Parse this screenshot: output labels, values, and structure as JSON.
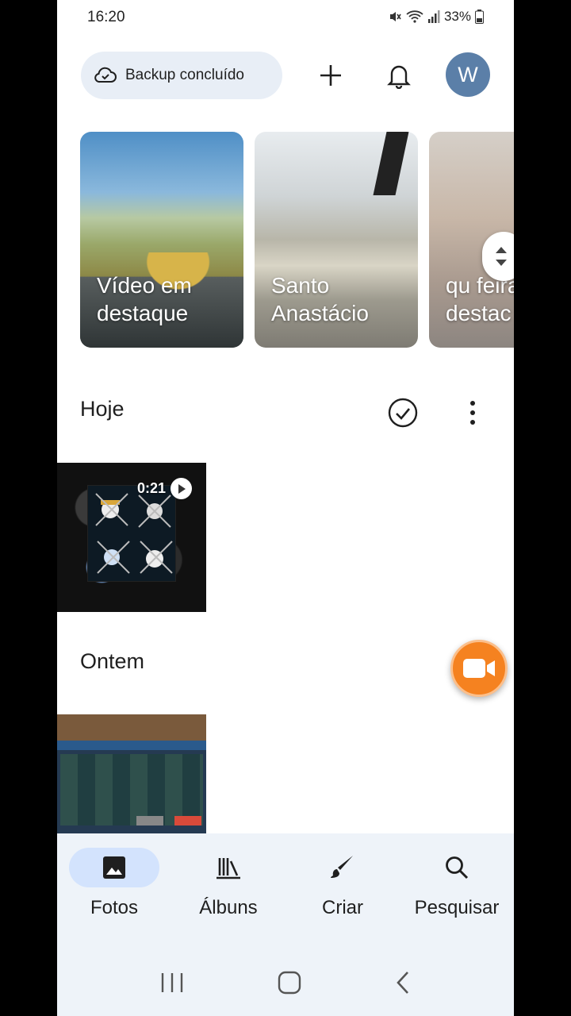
{
  "status_bar": {
    "time": "16:20",
    "battery": "33%"
  },
  "header": {
    "backup_label": "Backup concluído",
    "avatar_initial": "W",
    "icons": [
      "cloud-check-icon",
      "plus-icon",
      "bell-icon"
    ]
  },
  "memories": [
    {
      "title": "Vídeo em destaque"
    },
    {
      "title": "Santo Anastácio"
    },
    {
      "title": "qu feira destac"
    }
  ],
  "sections": [
    {
      "title": "Hoje",
      "items": [
        {
          "type": "video",
          "duration": "0:21"
        }
      ]
    },
    {
      "title": "Ontem",
      "items": [
        {
          "type": "image"
        }
      ]
    }
  ],
  "bottom_nav": [
    {
      "label": "Fotos",
      "icon": "photo-icon",
      "active": true
    },
    {
      "label": "Álbuns",
      "icon": "albums-icon",
      "active": false
    },
    {
      "label": "Criar",
      "icon": "brush-icon",
      "active": false
    },
    {
      "label": "Pesquisar",
      "icon": "search-icon",
      "active": false
    }
  ],
  "colors": {
    "accent": "#d3e3fd",
    "fab": "#f58220",
    "avatar": "#5b7fa8",
    "pill": "#e8eef6"
  }
}
